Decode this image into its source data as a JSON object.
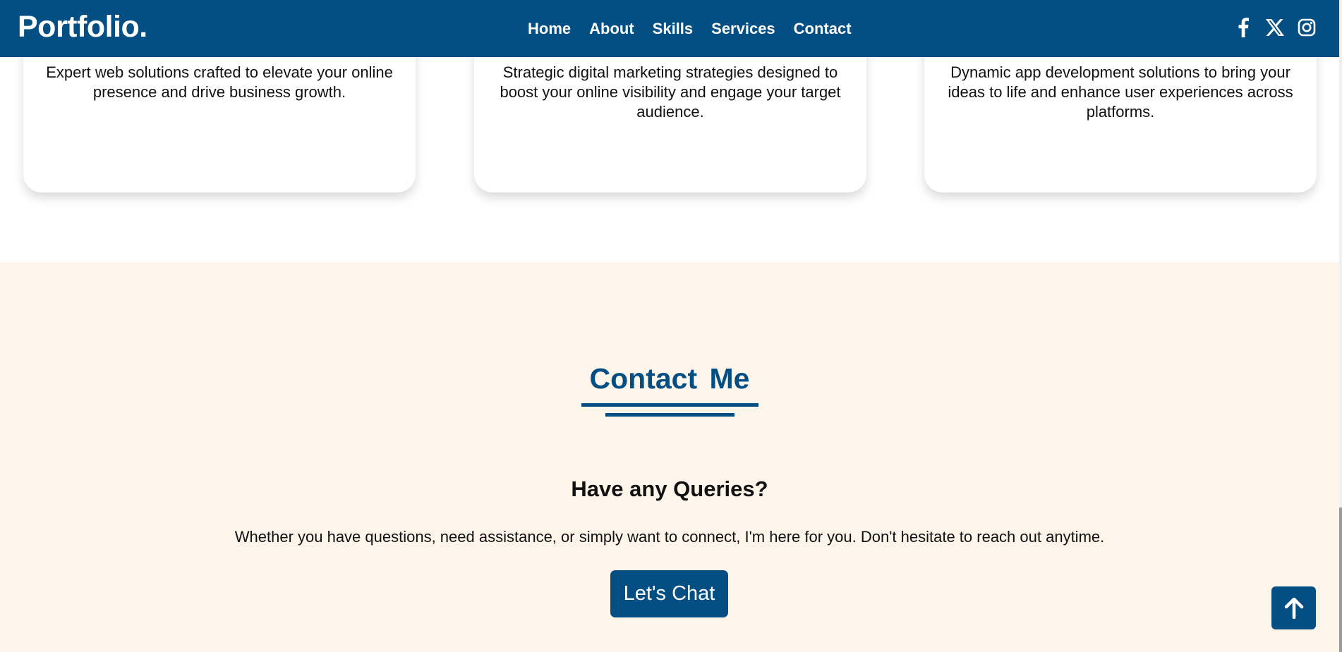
{
  "header": {
    "logo": "Portfolio.",
    "nav": [
      "Home",
      "About",
      "Skills",
      "Services",
      "Contact"
    ],
    "socials": [
      "facebook-icon",
      "x-twitter-icon",
      "instagram-icon"
    ]
  },
  "services": {
    "cards": [
      {
        "description": "Expert web solutions crafted to elevate your online presence and drive business growth."
      },
      {
        "description": "Strategic digital marketing strategies designed to boost your online visibility and engage your target audience."
      },
      {
        "description": "Dynamic app development solutions to bring your ideas to life and enhance user experiences across platforms."
      }
    ]
  },
  "contact": {
    "title": "Contact Me",
    "subtitle": "Have any Queries?",
    "description": "Whether you have questions, need assistance, or simply want to connect, I'm here for you. Don't hesitate to reach out anytime.",
    "button_label": "Let's Chat"
  },
  "back_to_top": {
    "icon": "arrow-up-icon"
  },
  "colors": {
    "primary": "#034f84",
    "contact_bg": "#fdf4ea",
    "text": "#111111"
  }
}
